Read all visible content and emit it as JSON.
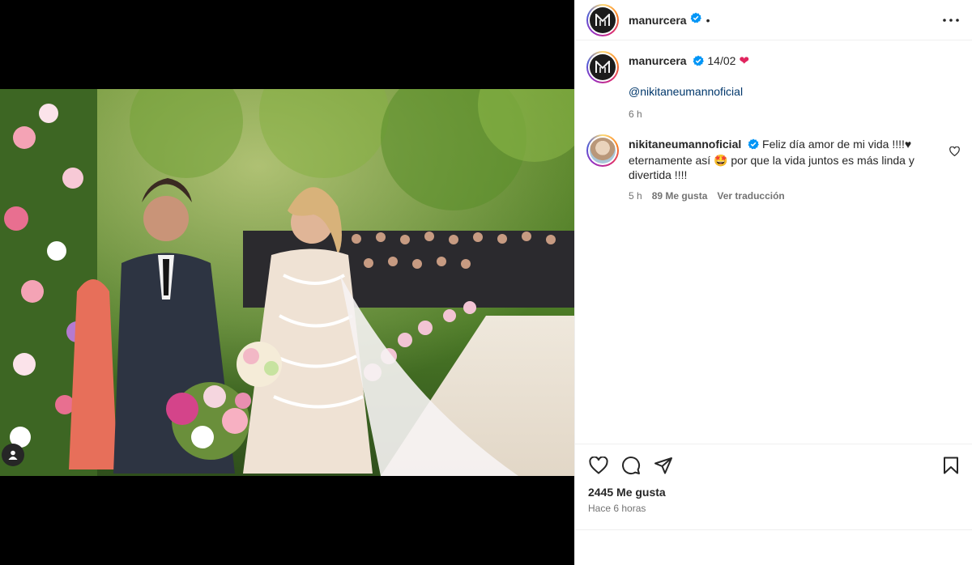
{
  "post": {
    "username": "manurcera",
    "separator": "•",
    "caption_text": "14/02",
    "caption_emoji": "❤",
    "mention": "@nikitaneumannoficial",
    "caption_time": "6 h"
  },
  "comment": {
    "username": "nikitaneumannoficial",
    "text": "Feliz día amor de mi vida !!!!♥ eternamente así 🤩 por que la vida juntos es más linda y divertida !!!!",
    "time": "5 h",
    "likes": "89 Me gusta",
    "translate": "Ver traducción"
  },
  "stats": {
    "likes": "2445 Me gusta",
    "posted": "Hace 6 horas"
  },
  "icons": {
    "more": "more-horizontal-icon",
    "like": "heart-icon",
    "comment": "comment-bubble-icon",
    "share": "paper-plane-icon",
    "save": "bookmark-icon",
    "tag": "user-tag-icon",
    "verified": "verified-badge-icon"
  },
  "colors": {
    "verified": "#0095f6",
    "link": "#00376b",
    "muted": "#737373",
    "heart": "#e0245e"
  }
}
